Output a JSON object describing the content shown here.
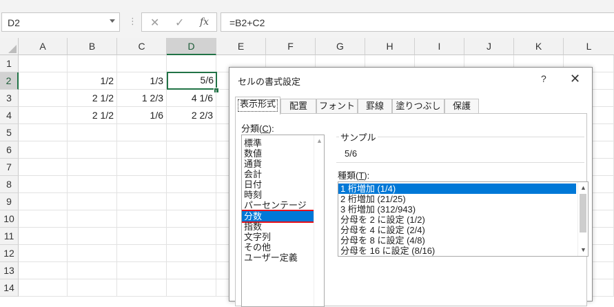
{
  "formula_bar": {
    "name_box": "D2",
    "cancel_glyph": "✕",
    "enter_glyph": "✓",
    "fx_glyph": "fx",
    "formula": "=B2+C2"
  },
  "grid": {
    "columns": [
      "A",
      "B",
      "C",
      "D",
      "E",
      "F",
      "G",
      "H",
      "I",
      "J",
      "K",
      "L"
    ],
    "rows": [
      "1",
      "2",
      "3",
      "4",
      "5",
      "6",
      "7",
      "8",
      "9",
      "10",
      "11",
      "12",
      "13",
      "14"
    ],
    "active_cell": "D2",
    "cells": {
      "B2": "1/2",
      "C2": "1/3",
      "D2": "5/6",
      "B3": "2 1/2",
      "C3": "1 2/3",
      "D3": "4 1/6",
      "B4": "2 1/2",
      "C4": "1/6",
      "D4": "2 2/3"
    }
  },
  "dialog": {
    "title": "セルの書式設定",
    "help": "?",
    "close": "✕",
    "tabs": [
      "表示形式",
      "配置",
      "フォント",
      "罫線",
      "塗りつぶし",
      "保護"
    ],
    "active_tab": "表示形式",
    "category_label_text": "分類(",
    "category_label_key": "C",
    "category_label_end": "):",
    "categories": [
      "標準",
      "数値",
      "通貨",
      "会計",
      "日付",
      "時刻",
      "パーセンテージ",
      "分数",
      "指数",
      "文字列",
      "その他",
      "ユーザー定義"
    ],
    "selected_category": "分数",
    "sample_label": "サンプル",
    "sample_value": "5/6",
    "type_label_text": "種類(",
    "type_label_key": "T",
    "type_label_end": "):",
    "types": [
      "1 桁増加 (1/4)",
      "2 桁増加 (21/25)",
      "3 桁増加 (312/943)",
      "分母を 2 に設定 (1/2)",
      "分母を 4 に設定 (2/4)",
      "分母を 8 に設定 (4/8)",
      "分母を 16 に設定 (8/16)"
    ],
    "selected_type": "1 桁増加 (1/4)"
  },
  "colors": {
    "excel_green": "#217346",
    "selection_blue": "#0078d7",
    "highlight_red": "#e8101a"
  }
}
